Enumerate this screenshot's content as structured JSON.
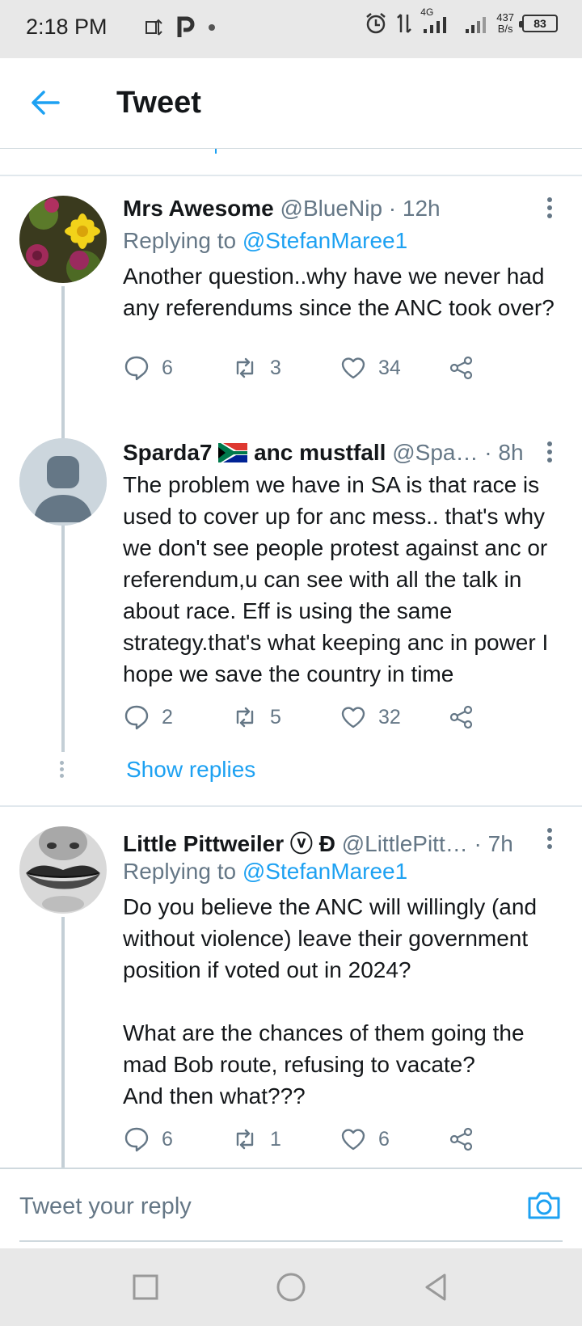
{
  "status_bar": {
    "time": "2:18 PM",
    "network": "4G",
    "speed_value": "437",
    "speed_unit": "B/s",
    "battery": "83",
    "icons": [
      "data-sync-icon",
      "parking-p-icon",
      "dot-icon",
      "alarm-icon",
      "data-transfer-icon",
      "signal-icon",
      "signal-icon-2",
      "battery-icon"
    ]
  },
  "header": {
    "title": "Tweet",
    "back_icon": "arrow-left-icon"
  },
  "tweets": [
    {
      "name": "Mrs Awesome",
      "handle": "@BlueNip",
      "time": "· 12h",
      "replying_label": "Replying to",
      "replying_to": "@StefanMaree1",
      "text": "Another question..why have we never had any referendums since the ANC took over?",
      "replies": "6",
      "retweets": "3",
      "likes": "34"
    },
    {
      "name": "Sparda7",
      "name_suffix": "anc mustfall",
      "handle": "@Spa…",
      "time": "· 8h",
      "text": "The problem we have in SA is that race is used to cover up for anc mess.. that's why we don't see people protest against anc or referendum,u can see with all the talk in about race. Eff is using the same strategy.that's what keeping anc in power I hope we save the country in time",
      "replies": "2",
      "retweets": "5",
      "likes": "32",
      "show_replies": "Show replies"
    },
    {
      "name": "Little Pittweiler ⓥ Đ",
      "handle": "@LittlePitt…",
      "time": "· 7h",
      "replying_label": "Replying to",
      "replying_to": "@StefanMaree1",
      "text": "Do you believe the ANC will willingly (and without violence) leave their government position if voted out in 2024?\n\nWhat are the chances of them going the mad Bob route, refusing to vacate?\nAnd then what???",
      "replies": "6",
      "retweets": "1",
      "likes": "6"
    }
  ],
  "reply_bar": {
    "placeholder": "Tweet your reply",
    "camera_icon": "camera-icon"
  },
  "colors": {
    "accent": "#1da1f2",
    "muted": "#657786",
    "text": "#14171a",
    "thread_line": "#c4cfd6"
  }
}
